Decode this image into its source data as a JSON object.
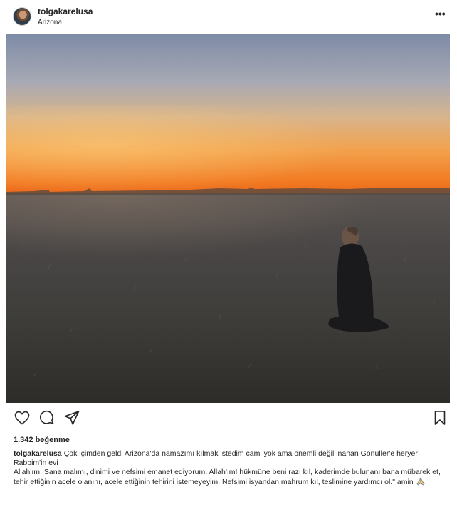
{
  "post": {
    "username": "tolgakarelusa",
    "location": "Arizona",
    "more_label": "•••",
    "likes_text": "1.342 beğenme",
    "caption": {
      "username": "tolgakarelusa",
      "line1": "Çok içimden geldi Arizona'da namazımı kılmak istedim cami yok ama önemli değil inanan Gönüller'e heryer Rabbim'in evi",
      "line2": "Allah'ım! Sana malımı, dinimi ve nefsimi emanet ediyorum. Allah'ım! hükmüne beni razı kıl, kaderimde bulunanı bana mübarek et, tehir ettiğinin acele olanını, acele ettiğinin tehirini istemeyeyim. Nefsimi isyandan mahrum kıl, teslimine yardımcı ol.\" amin"
    }
  },
  "icons": [
    "heart-icon",
    "comment-icon",
    "share-icon",
    "bookmark-icon",
    "praying-hands-icon"
  ],
  "colors": {
    "text": "#262626",
    "border": "#dbdbdb",
    "sky_top": "#7f8ea8",
    "sunset": "#f2a04a",
    "horizon": "#f06a1a",
    "field": "#3d3d3a"
  }
}
